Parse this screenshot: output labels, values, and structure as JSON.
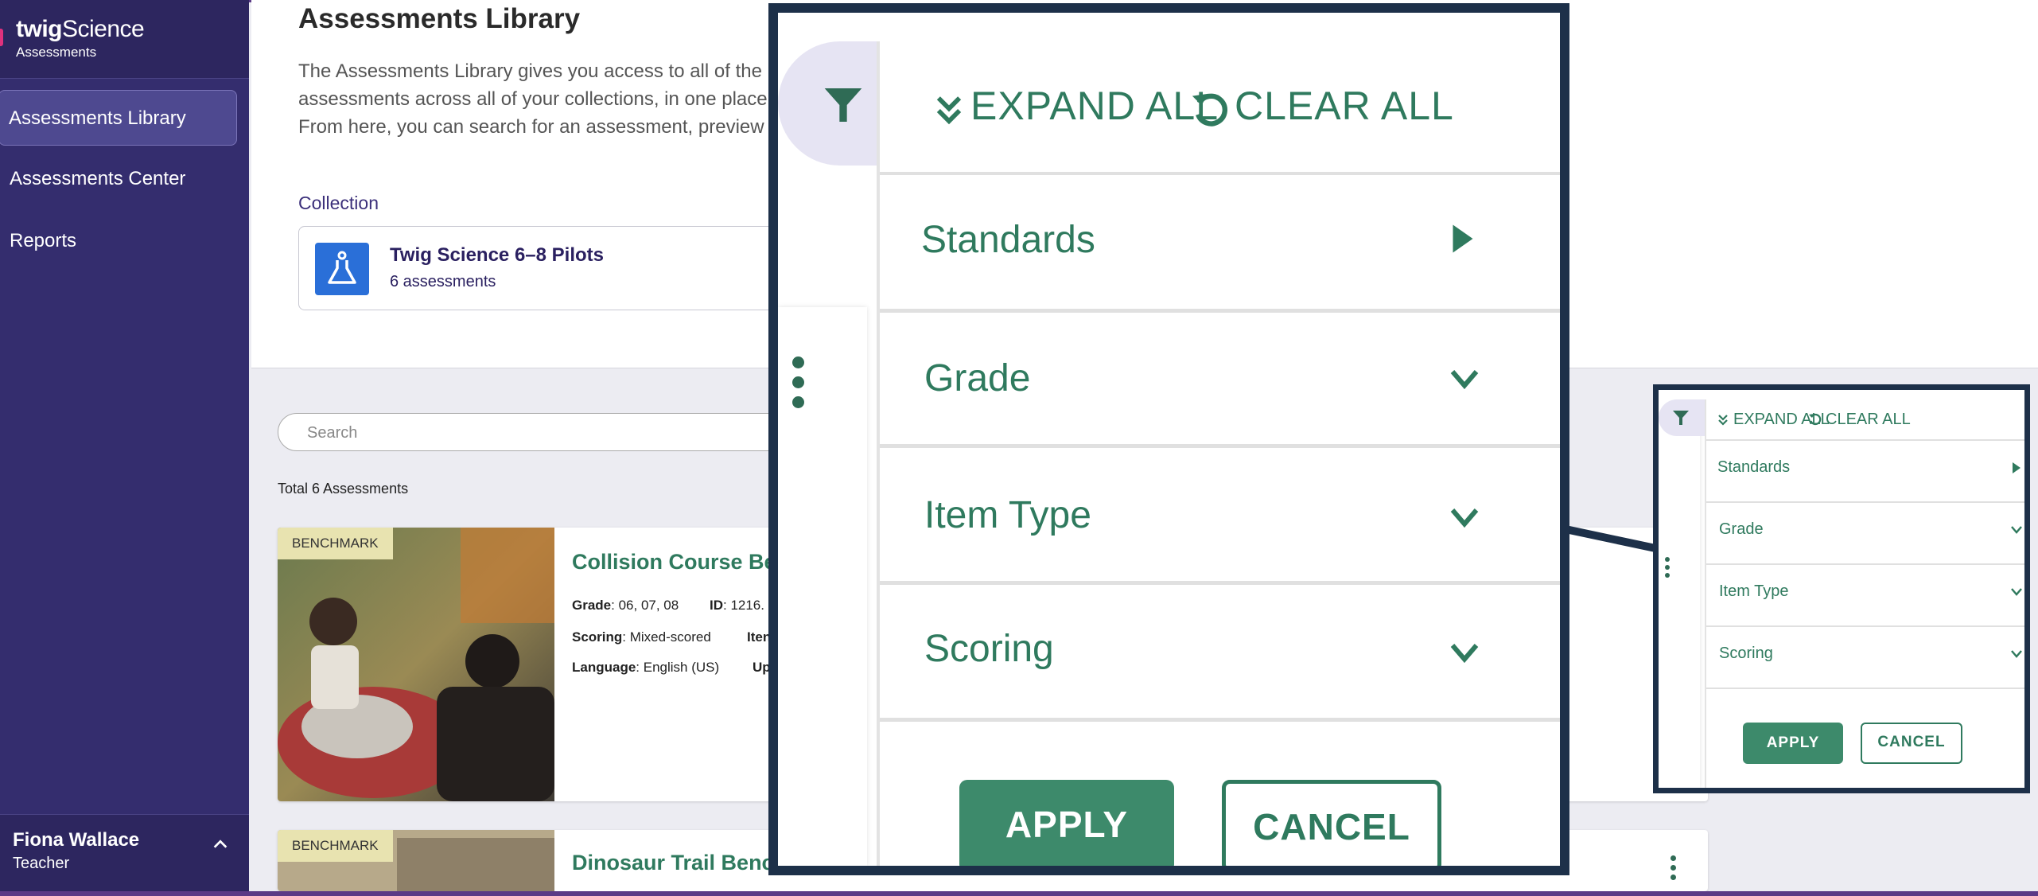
{
  "app": {
    "brand_name": "twig",
    "brand_name2": "Science",
    "brand_sub": "Assessments"
  },
  "sidebar": {
    "items": [
      {
        "label": "Assessments Library"
      },
      {
        "label": "Assessments Center"
      },
      {
        "label": "Reports"
      }
    ],
    "user": {
      "name": "Fiona Wallace",
      "role": "Teacher"
    }
  },
  "header": {
    "title": "Assessments Library",
    "description": "The Assessments Library gives you access to all of the assessments across all of your collections, in one place. From here, you can search for an assessment, preview them, and assign them to your students.",
    "collection_label": "Collection",
    "collection": {
      "title": "Twig Science 6–8 Pilots",
      "subtitle": "6 assessments"
    }
  },
  "list": {
    "search_placeholder": "Search",
    "total": "Total 6 Assessments",
    "cards": [
      {
        "tag": "BENCHMARK",
        "title": "Collision Course Be",
        "grade_label": "Grade",
        "grade": ": 06, 07, 08",
        "id_label": "ID",
        "id": ": 1216.",
        "scoring_label": "Scoring",
        "scoring": ": Mixed-scored",
        "items_label": "Iten",
        "language_label": "Language",
        "language": ": English (US)",
        "updated_label": "Up"
      },
      {
        "tag": "BENCHMARK",
        "title": "Dinosaur Trail Benc"
      }
    ]
  },
  "filter": {
    "expand_all": "EXPAND ALL",
    "clear_all": "CLEAR ALL",
    "sections": [
      "Standards",
      "Grade",
      "Item Type",
      "Scoring"
    ],
    "apply": "APPLY",
    "cancel": "CANCEL"
  },
  "colors": {
    "sidebar": "#342d6e",
    "accent_green": "#3d8a6b",
    "frame": "#1d3049"
  }
}
